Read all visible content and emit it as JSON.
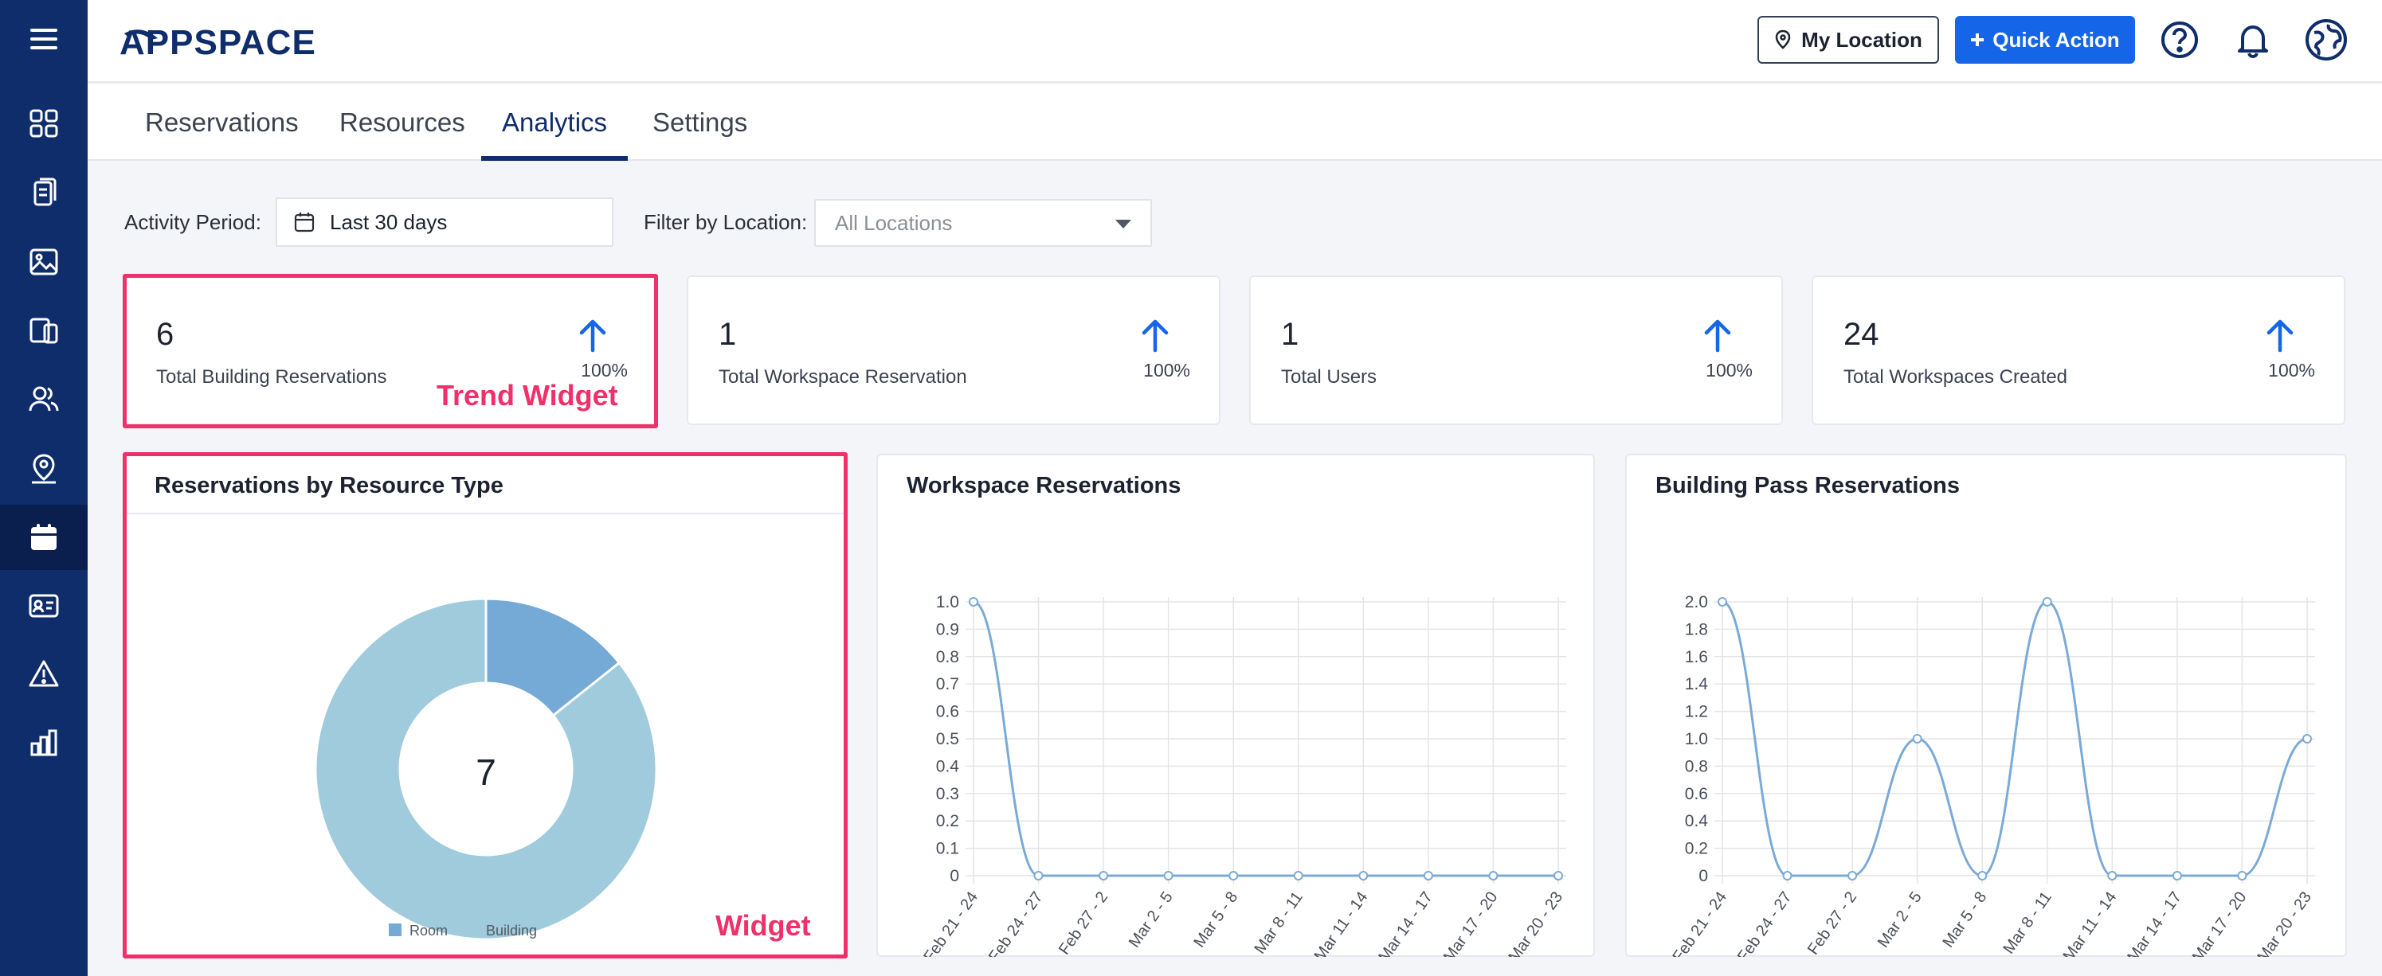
{
  "app": {
    "name": "APPSPACE"
  },
  "sidebar": {
    "items": [
      {
        "icon": "menu-icon"
      },
      {
        "icon": "dashboard-grid-icon"
      },
      {
        "icon": "content-cards-icon"
      },
      {
        "icon": "image-library-icon"
      },
      {
        "icon": "devices-icon"
      },
      {
        "icon": "users-icon"
      },
      {
        "icon": "user-location-icon"
      },
      {
        "icon": "calendar-icon",
        "active": true
      },
      {
        "icon": "id-card-icon"
      },
      {
        "icon": "alert-icon"
      },
      {
        "icon": "bar-chart-icon"
      }
    ]
  },
  "header": {
    "my_location": "My Location",
    "quick_action": "Quick Action",
    "icons": [
      "help-icon",
      "bell-icon",
      "globe-icon"
    ]
  },
  "tabs": [
    {
      "label": "Reservations"
    },
    {
      "label": "Resources"
    },
    {
      "label": "Analytics",
      "active": true
    },
    {
      "label": "Settings"
    }
  ],
  "filters": {
    "activity_label": "Activity Period:",
    "activity_value": "Last 30 days",
    "location_label": "Filter by Location:",
    "location_placeholder": "All Locations"
  },
  "trend_cards": [
    {
      "value": "6",
      "label": "Total Building Reservations",
      "change": "100%"
    },
    {
      "value": "1",
      "label": "Total Workspace Reservation",
      "change": "100%"
    },
    {
      "value": "1",
      "label": "Total Users",
      "change": "100%"
    },
    {
      "value": "24",
      "label": "Total Workspaces Created",
      "change": "100%"
    }
  ],
  "annotations": {
    "trend": "Trend Widget",
    "widget": "Widget"
  },
  "colors": {
    "accent": "#1565e8",
    "sidebar": "#0f2d6b",
    "highlight": "#f0306a",
    "room": "#75a9d6",
    "building": "#9fcbdc",
    "line": "#7aaad6"
  },
  "widgets": {
    "donut_title": "Reservations by Resource Type",
    "donut_center": "7",
    "workspace_title": "Workspace Reservations",
    "building_title": "Building Pass Reservations"
  },
  "chart_data": [
    {
      "type": "pie",
      "title": "Reservations by Resource Type",
      "categories": [
        "Room",
        "Building"
      ],
      "values": [
        1,
        6
      ],
      "center_label": "7",
      "legend": "bottom"
    },
    {
      "type": "line",
      "title": "Workspace Reservations",
      "categories": [
        "Feb 21 - 24",
        "Feb 24 - 27",
        "Feb 27 - 2",
        "Mar 2 - 5",
        "Mar 5 - 8",
        "Mar 8 - 11",
        "Mar 11 - 14",
        "Mar 14 - 17",
        "Mar 17 - 20",
        "Mar 20 - 23"
      ],
      "values": [
        1,
        0,
        0,
        0,
        0,
        0,
        0,
        0,
        0,
        0
      ],
      "ylim": [
        0,
        1.0
      ],
      "yticks": [
        "1.0",
        "0.9",
        "0.8",
        "0.7",
        "0.6",
        "0.5",
        "0.4",
        "0.3",
        "0.2",
        "0.1",
        "0"
      ],
      "grid": true
    },
    {
      "type": "line",
      "title": "Building Pass Reservations",
      "categories": [
        "Feb 21 - 24",
        "Feb 24 - 27",
        "Feb 27 - 2",
        "Mar 2 - 5",
        "Mar 5 - 8",
        "Mar 8 - 11",
        "Mar 11 - 14",
        "Mar 14 - 17",
        "Mar 17 - 20",
        "Mar 20 - 23"
      ],
      "values": [
        2,
        0,
        0,
        1,
        0,
        2,
        0,
        0,
        0,
        1
      ],
      "ylim": [
        0,
        2.0
      ],
      "yticks": [
        "2.0",
        "1.8",
        "1.6",
        "1.4",
        "1.2",
        "1.0",
        "0.8",
        "0.6",
        "0.4",
        "0.2",
        "0"
      ],
      "grid": true
    }
  ]
}
